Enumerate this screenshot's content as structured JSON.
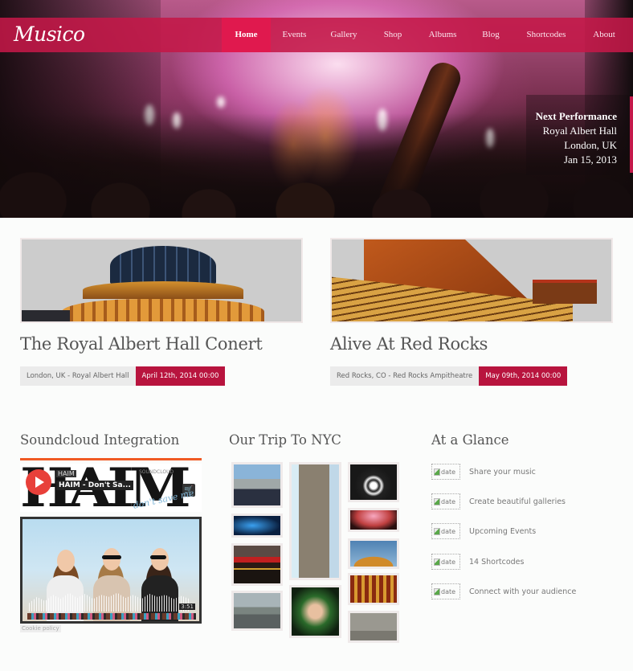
{
  "site": {
    "logo": "Musico",
    "nav": [
      {
        "label": "Home",
        "active": true
      },
      {
        "label": "Events",
        "active": false
      },
      {
        "label": "Gallery",
        "active": false
      },
      {
        "label": "Shop",
        "active": false
      },
      {
        "label": "Albums",
        "active": false
      },
      {
        "label": "Blog",
        "active": false
      },
      {
        "label": "Shortcodes",
        "active": false
      },
      {
        "label": "About",
        "active": false
      }
    ]
  },
  "hero": {
    "next_performance": {
      "title": "Next Performance",
      "venue": "Royal Albert Hall",
      "city": "London, UK",
      "date": "Jan 15, 2013"
    }
  },
  "events": [
    {
      "title": "The Royal Albert Hall Conert",
      "location": "London, UK - Royal Albert Hall",
      "date": "April 12th, 2014 00:00",
      "image": "royal-albert-hall"
    },
    {
      "title": "Alive At Red Rocks",
      "location": "Red Rocks, CO - Red Rocks Ampitheatre",
      "date": "May 09th, 2014 00:00",
      "image": "red-rocks"
    }
  ],
  "widgets": {
    "soundcloud": {
      "title": "Soundcloud Integration",
      "artist": "HAIM",
      "track": "HAIM - Don't Sa...",
      "brand": "SOUNDCLOUD",
      "script_text": "don't save me",
      "duration": "3:51",
      "cookie_label": "Cookie policy",
      "accent": "#f05a24"
    },
    "gallery": {
      "title": "Our Trip To NYC",
      "images": [
        "nyc-skyline",
        "concert-blue-lights",
        "nbc-studios",
        "airport-plane",
        "flatiron-building",
        "singer-microphone",
        "guitar-player",
        "concert-crowd",
        "royal-albert-hall",
        "theater-seats",
        "wall-plaque"
      ]
    },
    "glance": {
      "title": "At a Glance",
      "alt": "date",
      "items": [
        "Share your music",
        "Create beautiful galleries",
        "Upcoming Events",
        "14 Shortcodes",
        "Connect with your audience"
      ]
    }
  },
  "colors": {
    "brand": "#c4184a",
    "nav_active": "#e0194e",
    "date_badge": "#b8143e"
  }
}
